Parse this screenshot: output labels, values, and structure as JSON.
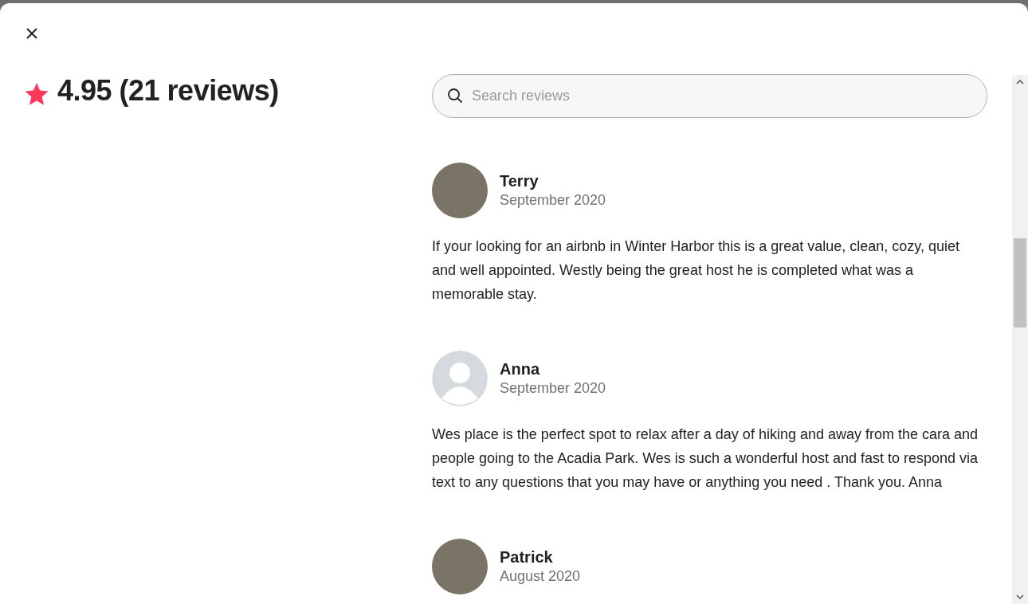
{
  "rating": {
    "score": "4.95 (21 reviews)"
  },
  "search": {
    "placeholder": "Search reviews"
  },
  "reviews": [
    {
      "name": "Terry",
      "date": "September 2020",
      "kind": "photo",
      "text": "If your looking for an airbnb in Winter Harbor this is a great value, clean, cozy, quiet and well appointed. Westly being the great host he is completed what was a memorable stay."
    },
    {
      "name": "Anna",
      "date": "September 2020",
      "kind": "default",
      "text": "Wes place is the perfect spot to relax after a day of hiking and away from the cara and people going to the Acadia Park. Wes is such a wonderful host and fast to respond via text to any questions that you may have or anything you need . Thank you. Anna"
    },
    {
      "name": "Patrick",
      "date": "August 2020",
      "kind": "photo"
    }
  ]
}
